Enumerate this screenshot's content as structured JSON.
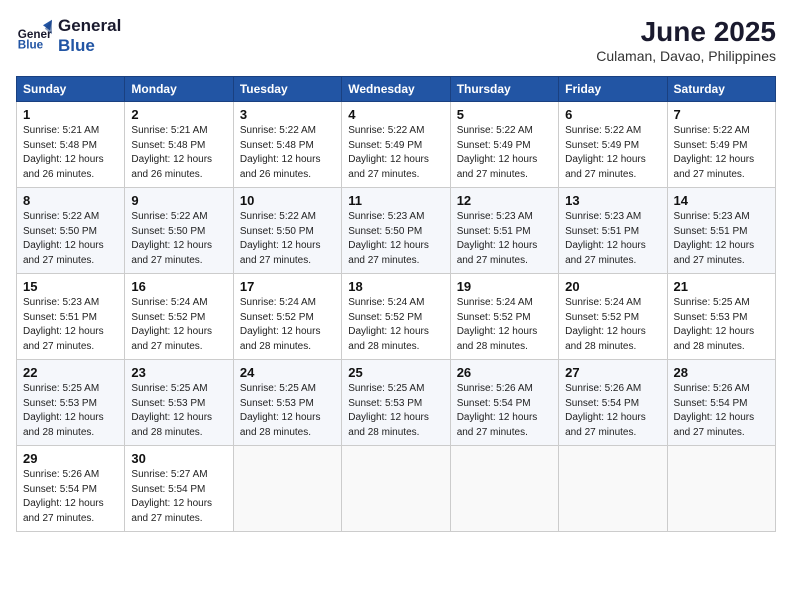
{
  "logo": {
    "line1": "General",
    "line2": "Blue"
  },
  "title": "June 2025",
  "subtitle": "Culaman, Davao, Philippines",
  "days_of_week": [
    "Sunday",
    "Monday",
    "Tuesday",
    "Wednesday",
    "Thursday",
    "Friday",
    "Saturday"
  ],
  "weeks": [
    [
      {
        "day": "1",
        "sunrise": "5:21 AM",
        "sunset": "5:48 PM",
        "daylight": "12 hours and 26 minutes."
      },
      {
        "day": "2",
        "sunrise": "5:21 AM",
        "sunset": "5:48 PM",
        "daylight": "12 hours and 26 minutes."
      },
      {
        "day": "3",
        "sunrise": "5:22 AM",
        "sunset": "5:48 PM",
        "daylight": "12 hours and 26 minutes."
      },
      {
        "day": "4",
        "sunrise": "5:22 AM",
        "sunset": "5:49 PM",
        "daylight": "12 hours and 27 minutes."
      },
      {
        "day": "5",
        "sunrise": "5:22 AM",
        "sunset": "5:49 PM",
        "daylight": "12 hours and 27 minutes."
      },
      {
        "day": "6",
        "sunrise": "5:22 AM",
        "sunset": "5:49 PM",
        "daylight": "12 hours and 27 minutes."
      },
      {
        "day": "7",
        "sunrise": "5:22 AM",
        "sunset": "5:49 PM",
        "daylight": "12 hours and 27 minutes."
      }
    ],
    [
      {
        "day": "8",
        "sunrise": "5:22 AM",
        "sunset": "5:50 PM",
        "daylight": "12 hours and 27 minutes."
      },
      {
        "day": "9",
        "sunrise": "5:22 AM",
        "sunset": "5:50 PM",
        "daylight": "12 hours and 27 minutes."
      },
      {
        "day": "10",
        "sunrise": "5:22 AM",
        "sunset": "5:50 PM",
        "daylight": "12 hours and 27 minutes."
      },
      {
        "day": "11",
        "sunrise": "5:23 AM",
        "sunset": "5:50 PM",
        "daylight": "12 hours and 27 minutes."
      },
      {
        "day": "12",
        "sunrise": "5:23 AM",
        "sunset": "5:51 PM",
        "daylight": "12 hours and 27 minutes."
      },
      {
        "day": "13",
        "sunrise": "5:23 AM",
        "sunset": "5:51 PM",
        "daylight": "12 hours and 27 minutes."
      },
      {
        "day": "14",
        "sunrise": "5:23 AM",
        "sunset": "5:51 PM",
        "daylight": "12 hours and 27 minutes."
      }
    ],
    [
      {
        "day": "15",
        "sunrise": "5:23 AM",
        "sunset": "5:51 PM",
        "daylight": "12 hours and 27 minutes."
      },
      {
        "day": "16",
        "sunrise": "5:24 AM",
        "sunset": "5:52 PM",
        "daylight": "12 hours and 27 minutes."
      },
      {
        "day": "17",
        "sunrise": "5:24 AM",
        "sunset": "5:52 PM",
        "daylight": "12 hours and 28 minutes."
      },
      {
        "day": "18",
        "sunrise": "5:24 AM",
        "sunset": "5:52 PM",
        "daylight": "12 hours and 28 minutes."
      },
      {
        "day": "19",
        "sunrise": "5:24 AM",
        "sunset": "5:52 PM",
        "daylight": "12 hours and 28 minutes."
      },
      {
        "day": "20",
        "sunrise": "5:24 AM",
        "sunset": "5:52 PM",
        "daylight": "12 hours and 28 minutes."
      },
      {
        "day": "21",
        "sunrise": "5:25 AM",
        "sunset": "5:53 PM",
        "daylight": "12 hours and 28 minutes."
      }
    ],
    [
      {
        "day": "22",
        "sunrise": "5:25 AM",
        "sunset": "5:53 PM",
        "daylight": "12 hours and 28 minutes."
      },
      {
        "day": "23",
        "sunrise": "5:25 AM",
        "sunset": "5:53 PM",
        "daylight": "12 hours and 28 minutes."
      },
      {
        "day": "24",
        "sunrise": "5:25 AM",
        "sunset": "5:53 PM",
        "daylight": "12 hours and 28 minutes."
      },
      {
        "day": "25",
        "sunrise": "5:25 AM",
        "sunset": "5:53 PM",
        "daylight": "12 hours and 28 minutes."
      },
      {
        "day": "26",
        "sunrise": "5:26 AM",
        "sunset": "5:54 PM",
        "daylight": "12 hours and 27 minutes."
      },
      {
        "day": "27",
        "sunrise": "5:26 AM",
        "sunset": "5:54 PM",
        "daylight": "12 hours and 27 minutes."
      },
      {
        "day": "28",
        "sunrise": "5:26 AM",
        "sunset": "5:54 PM",
        "daylight": "12 hours and 27 minutes."
      }
    ],
    [
      {
        "day": "29",
        "sunrise": "5:26 AM",
        "sunset": "5:54 PM",
        "daylight": "12 hours and 27 minutes."
      },
      {
        "day": "30",
        "sunrise": "5:27 AM",
        "sunset": "5:54 PM",
        "daylight": "12 hours and 27 minutes."
      },
      null,
      null,
      null,
      null,
      null
    ]
  ]
}
